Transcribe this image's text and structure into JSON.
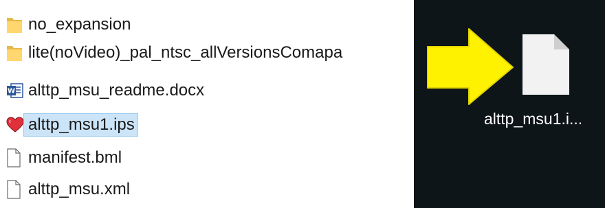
{
  "explorer": {
    "files": [
      {
        "name": "no_expansion",
        "icon": "folder-icon"
      },
      {
        "name": "lite(noVideo)_pal_ntsc_allVersionsComapa",
        "icon": "folder-icon"
      },
      {
        "name": "alttp_msu_readme.docx",
        "icon": "word-document-icon"
      },
      {
        "name": "alttp_msu1.ips",
        "icon": "heart-icon",
        "selected": true
      },
      {
        "name": "manifest.bml",
        "icon": "blank-file-icon"
      },
      {
        "name": "alttp_msu.xml",
        "icon": "blank-file-icon"
      }
    ]
  },
  "desktop": {
    "icon": "blank-file-icon",
    "label": "alttp_msu1.i...",
    "arrow_color": "#fff200",
    "background": "#0e1519"
  },
  "colors": {
    "folder": "#ffd76e",
    "selection": "#cce4f7",
    "heart": "#e0303a",
    "word_blue": "#2b579a"
  }
}
